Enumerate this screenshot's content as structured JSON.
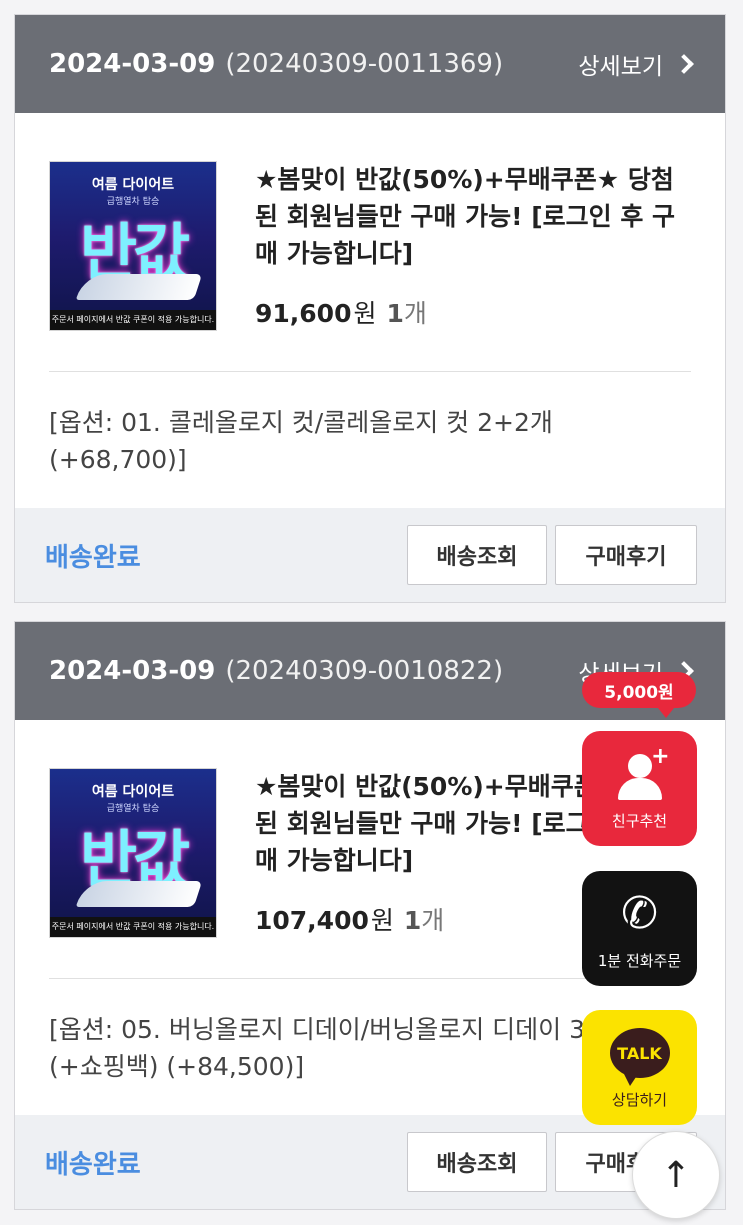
{
  "orders": [
    {
      "date": "2024-03-09",
      "order_number": "(20240309-0011369)",
      "detail_label": "상세보기",
      "thumb": {
        "top": "여름 다이어트",
        "sub": "급행열차 탑승",
        "big": "반값",
        "foot": "주문서 페이지에서 반값 쿠폰이 적용 가능합니다."
      },
      "title": "★봄맞이 반값(50%)+무배쿠폰★ 당첨된 회원님들만 구매 가능! [로그인 후 구매 가능합니다]",
      "price": "91,600",
      "currency": "원",
      "qty_num": "1",
      "qty_unit": "개",
      "option": "[옵션: 01. 콜레올로지 컷/콜레올로지 컷 2+2개 (+68,700)]",
      "status": "배송완료",
      "track_label": "배송조회",
      "review_label": "구매후기"
    },
    {
      "date": "2024-03-09",
      "order_number": "(20240309-0010822)",
      "detail_label": "상세보기",
      "thumb": {
        "top": "여름 다이어트",
        "sub": "급행열차 탑승",
        "big": "반값",
        "foot": "주문서 페이지에서 반값 쿠폰이 적용 가능합니다."
      },
      "title": "★봄맞이 반값(50%)+무배쿠폰★ 당첨된 회원님들만 구매 가능! [로그인 후 구매 가능합니다]",
      "price": "107,400",
      "currency": "원",
      "qty_num": "1",
      "qty_unit": "개",
      "option": "[옵션: 05. 버닝올로지 디데이/버닝올로지 디데이 3+3개 (+쇼핑백) (+84,500)]",
      "status": "배송완료",
      "track_label": "배송조회",
      "review_label": "구매후기"
    }
  ],
  "floating": {
    "reward_badge": "5,000원",
    "referral_label": "친구추천",
    "call_label": "1분 전화주문",
    "talk_icon_text": "TALK",
    "talk_label": "상담하기",
    "scroll_top_icon": "↑",
    "phone_icon": "✆",
    "plus_icon": "+"
  },
  "colors": {
    "header_bg": "#6b6e75",
    "status": "#4a8de0",
    "referral": "#e8283c",
    "kakao": "#fbe300"
  }
}
